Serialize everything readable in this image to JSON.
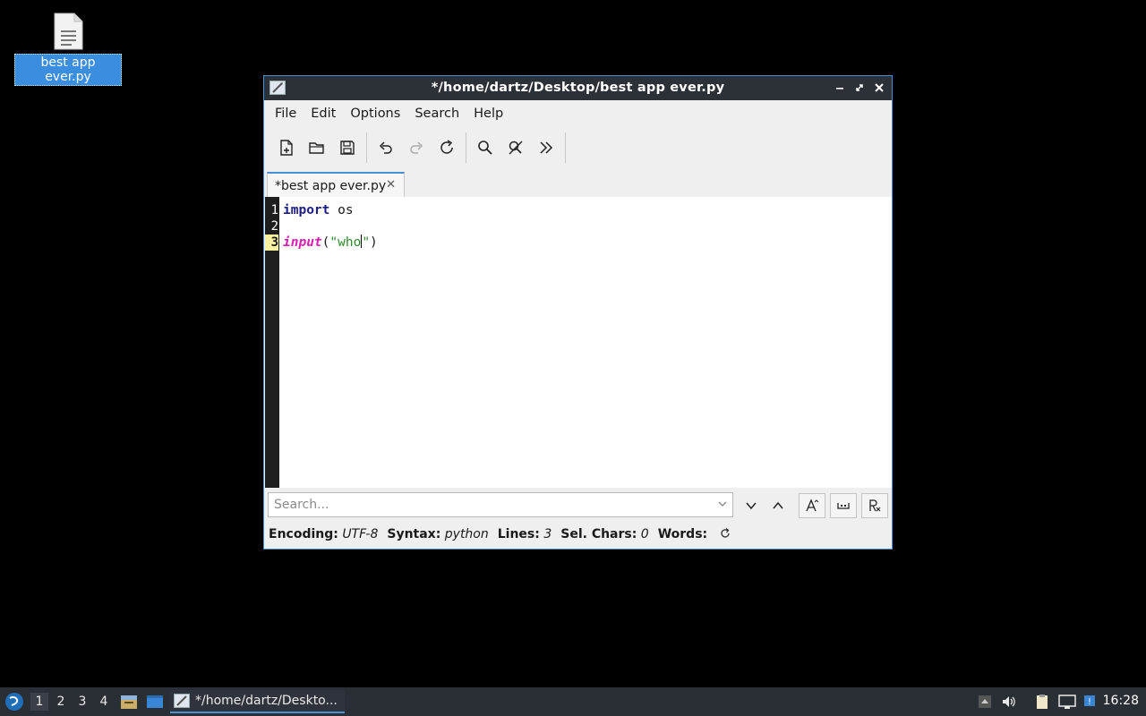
{
  "desktop": {
    "icon_label": "best app ever.py",
    "icon_name": "text-file-icon"
  },
  "window": {
    "title": "*/home/dartz/Desktop/best app ever.py",
    "accent": "#4a8fd4",
    "menu": [
      "File",
      "Edit",
      "Options",
      "Search",
      "Help"
    ],
    "toolbar": [
      "new-file",
      "open-file",
      "save",
      "undo",
      "redo",
      "reload",
      "find",
      "replace",
      "more"
    ],
    "tab_label": "*best app ever.py",
    "tab_close": "✕",
    "editor": {
      "line_numbers": [
        "1",
        "2",
        "3"
      ],
      "current_line": "3",
      "lines": [
        {
          "keyword": "import",
          "rest": " os"
        },
        {
          "text": ""
        },
        {
          "func": "input",
          "open": "(",
          "string_before_caret": "\"who",
          "string_after_caret": "\"",
          "close": ")"
        }
      ]
    },
    "search": {
      "placeholder": "Search..."
    },
    "status": {
      "encoding_label": "Encoding:",
      "encoding_value": "UTF-8",
      "syntax_label": "Syntax:",
      "syntax_value": "python",
      "lines_label": "Lines:",
      "lines_value": "3",
      "sel_label": "Sel. Chars:",
      "sel_value": "0",
      "words_label": "Words:"
    }
  },
  "taskbar": {
    "workspaces": [
      "1",
      "2",
      "3",
      "4"
    ],
    "active_workspace": "1",
    "task_label": "*/home/dartz/Deskto...",
    "clock": "16:28"
  }
}
